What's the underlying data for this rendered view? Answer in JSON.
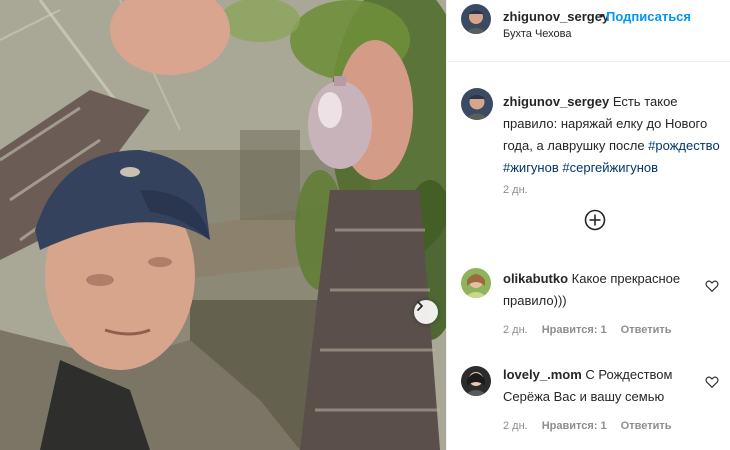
{
  "post": {
    "username": "zhigunov_sergey",
    "separator": "•",
    "follow_label": "Подписаться",
    "location": "Бухта Чехова"
  },
  "caption": {
    "username": "zhigunov_sergey",
    "text": "Есть такое правило: наряжай елку до Нового года, а лаврушку после",
    "hashtags": [
      "#рождество",
      "#жигунов",
      "#сергейжигунов"
    ],
    "time": "2 дн."
  },
  "comments": [
    {
      "username": "olikabutko",
      "text": "Какое прекрасное правило)))",
      "time": "2 дн.",
      "likes": "Нравится: 1",
      "reply": "Ответить"
    },
    {
      "username": "lovely_.mom",
      "text": "С Рождеством Серёжа Вас и вашу семью",
      "time": "2 дн.",
      "likes": "Нравится: 1",
      "reply": "Ответить"
    }
  ],
  "colors": {
    "link_blue": "#0095f6",
    "hashtag": "#00376b",
    "muted": "#8e8e8e",
    "text": "#262626"
  },
  "icons": [
    "chevron-right-icon",
    "add-comment-icon",
    "heart-icon"
  ]
}
